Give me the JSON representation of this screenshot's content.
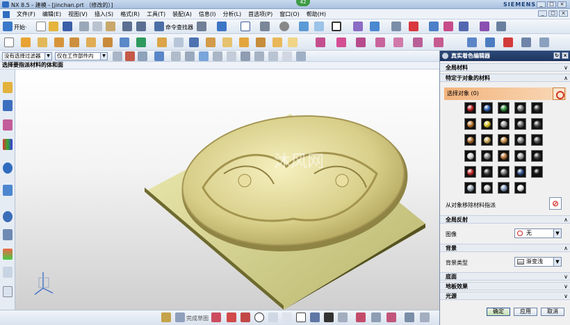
{
  "window": {
    "title": "NX 8.5 - 建模 - [jinchan.prt （修改的）]",
    "badge": "42",
    "brand": "SIEMENS",
    "controls": [
      "_",
      "□",
      "×"
    ]
  },
  "menubar": {
    "items": [
      "文件(F)",
      "编辑(E)",
      "视图(V)",
      "插入(S)",
      "格式(R)",
      "工具(T)",
      "装配(A)",
      "信息(I)",
      "分析(L)",
      "首选项(P)",
      "窗口(O)",
      "帮助(H)"
    ],
    "right_controls": [
      "_",
      "□",
      "×"
    ]
  },
  "toolbar": {
    "start_label": "开始·",
    "command_finder_label": "命令查找器"
  },
  "selection_bar": {
    "filter_value": "没有选择过滤器",
    "scope_value": "仅在工作部件内"
  },
  "cue_line": "选择要指派材料的体和面",
  "watermark": "沐风网",
  "statusbar": {
    "finish_sketch_label": "完成草图"
  },
  "panel": {
    "title": "真实着色编辑器",
    "sections": {
      "global_material": "全局材料",
      "object_material": "特定于对象的材料",
      "global_reflection": "全局反射",
      "background": "背景",
      "base": "底面",
      "stage_effect": "地板效果",
      "light": "光源"
    },
    "select_object_label": "选择对象 (0)",
    "remove_material_label": "从对象移除材料指派",
    "image_label": "图像",
    "image_value": "无",
    "background_type_label": "背景类型",
    "background_type_value": "渐变浅",
    "ok_label": "确定",
    "apply_label": "应用",
    "cancel_label": "取消"
  },
  "materials": [
    {
      "color": "#b82020"
    },
    {
      "color": "#2f5fae"
    },
    {
      "color": "#2d8b3a"
    },
    {
      "color": "#7a7a7a"
    },
    {
      "color": "#3a3a3a"
    },
    {
      "color": "#b8732c"
    },
    {
      "color": "#d8c22a"
    },
    {
      "color": "#9a9a9a"
    },
    {
      "color": "#6d6d6d"
    },
    {
      "color": "#4a4a4a"
    },
    {
      "color": "#a86a2b"
    },
    {
      "color": "#c9a657"
    },
    {
      "color": "#c58a46"
    },
    {
      "color": "#888888"
    },
    {
      "color": "#555555"
    },
    {
      "color": "#d0d0d0"
    },
    {
      "color": "#8b8b8b"
    },
    {
      "color": "#b5733a"
    },
    {
      "color": "#a0a0a0"
    },
    {
      "color": "#444444"
    },
    {
      "color": "#c02828"
    },
    {
      "color": "#3b3b3b"
    },
    {
      "color": "#6f6f6f"
    },
    {
      "color": "#2b4f86"
    },
    {
      "color": "#1a1a1a"
    },
    {
      "color": "#9aa6b4"
    },
    {
      "color": "#bfbfbf"
    },
    {
      "color": "#7f96b8"
    },
    {
      "color": "#e6e6e6"
    }
  ]
}
